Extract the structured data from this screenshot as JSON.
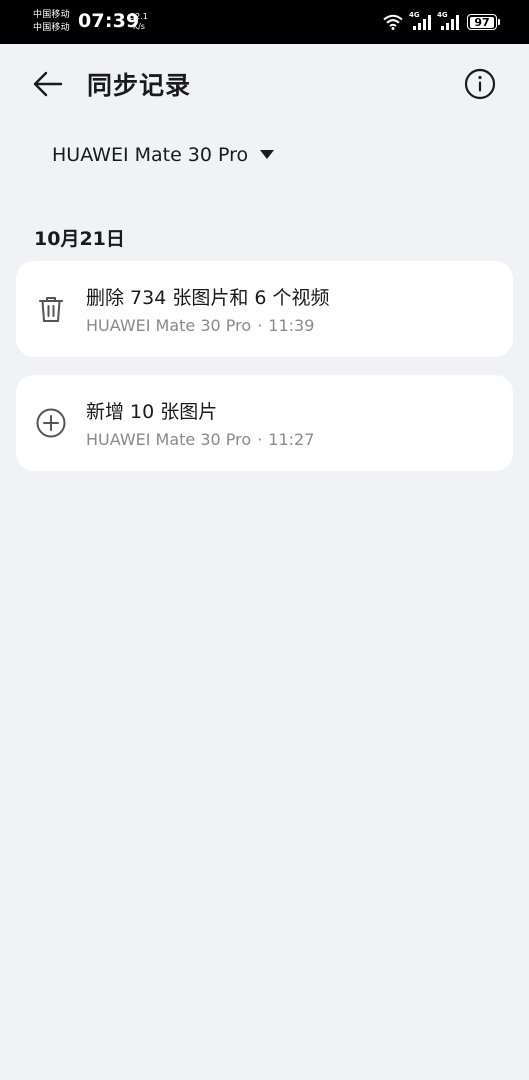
{
  "status_bar": {
    "carrier_1": "中国移动",
    "carrier_2": "中国移动",
    "time": "07:39",
    "net_speed_value": "32.1",
    "net_speed_unit": "K/s",
    "sim1_network": "4G",
    "sim2_network": "4G",
    "battery": "97"
  },
  "header": {
    "title": "同步记录",
    "back_icon": "arrow-left-icon",
    "info_icon": "info-circle-icon"
  },
  "device_selector": {
    "selected": "HUAWEI Mate 30 Pro",
    "icon": "caret-down-icon"
  },
  "records": {
    "date": "10月21日",
    "items": [
      {
        "icon": "trash-icon",
        "title": "删除 734 张图片和 6 个视频",
        "device": "HUAWEI Mate 30 Pro",
        "separator": "·",
        "time": "11:39"
      },
      {
        "icon": "plus-circle-icon",
        "title": "新增 10 张图片",
        "device": "HUAWEI Mate 30 Pro",
        "separator": "·",
        "time": "11:27"
      }
    ]
  }
}
